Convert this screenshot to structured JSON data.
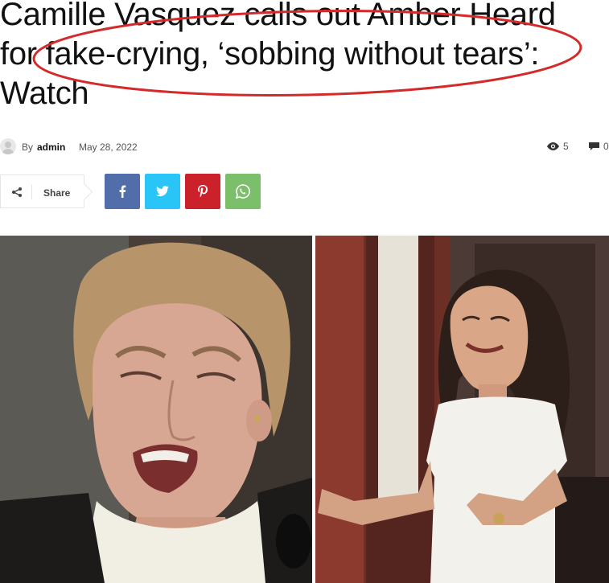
{
  "article": {
    "headline_lines": [
      "Camille Vasquez calls out Amber Heard",
      "for fake-crying, ‘sobbing without tears’:",
      "Watch"
    ]
  },
  "meta": {
    "by": "By",
    "author": "admin",
    "date": "May 28, 2022",
    "views": "5",
    "comments": "0"
  },
  "share": {
    "label": "Share",
    "buttons": [
      "facebook-icon",
      "twitter-icon",
      "pinterest-icon",
      "whatsapp-icon"
    ]
  },
  "colors": {
    "facebook": "#516eab",
    "twitter": "#29c5f6",
    "pinterest": "#ca212a",
    "whatsapp": "#7bbf6a",
    "annotation": "#d42a2a"
  }
}
